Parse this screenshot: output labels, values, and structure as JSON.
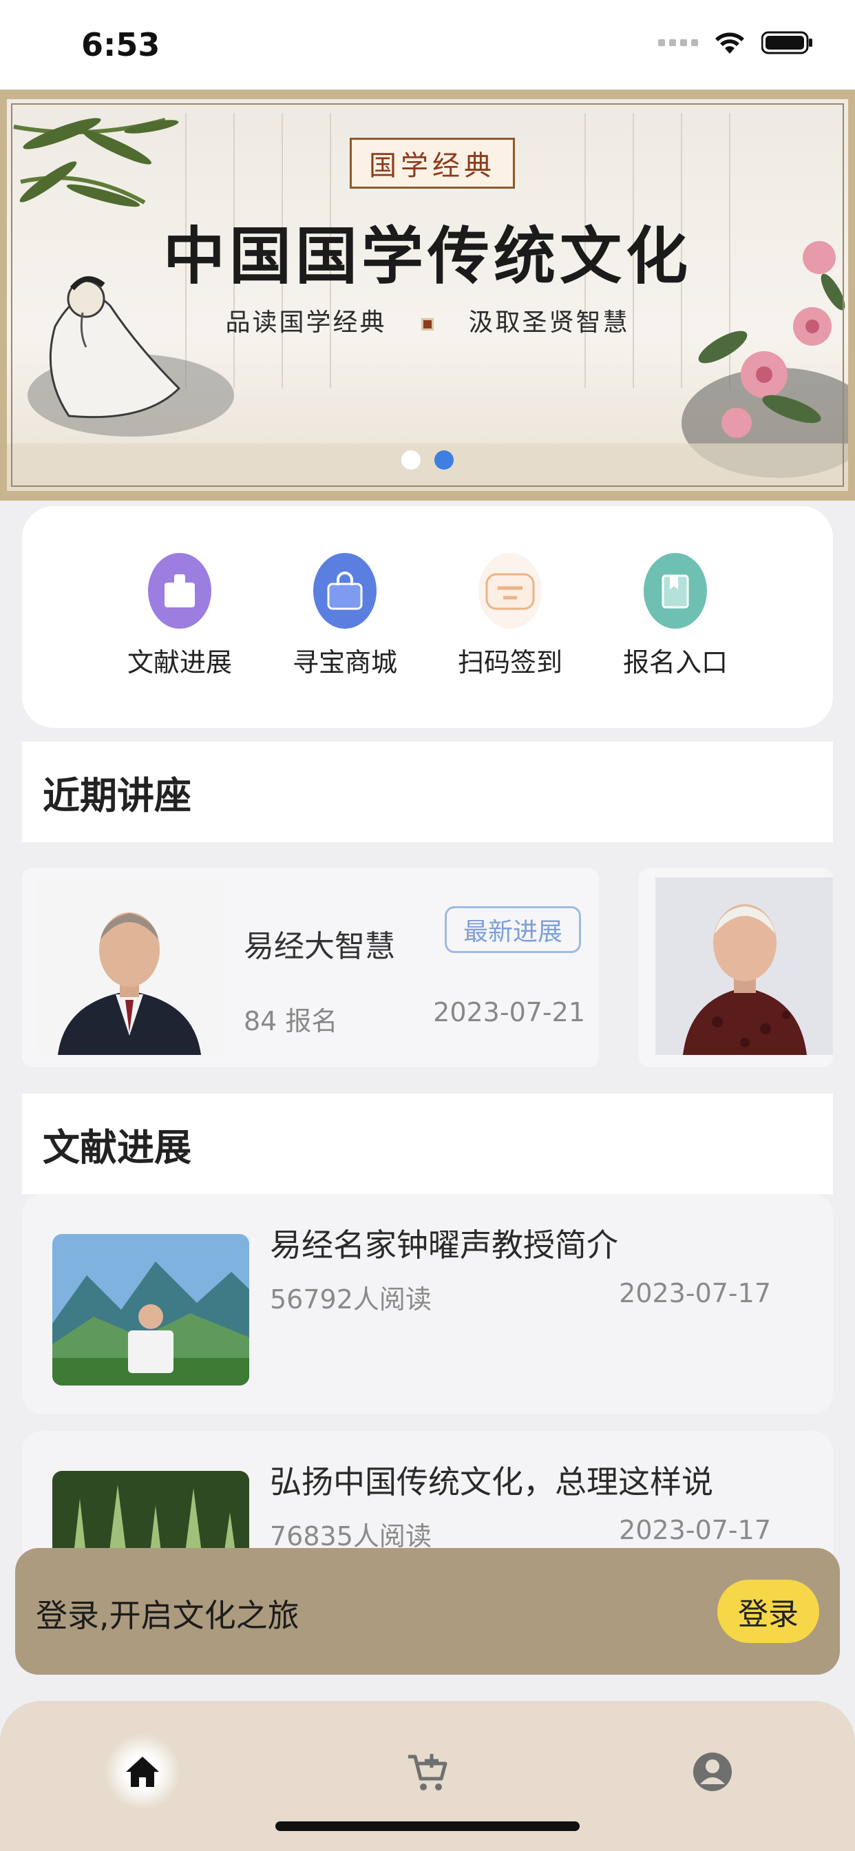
{
  "status_bar": {
    "time": "6:53"
  },
  "banner": {
    "tag": "国学经典",
    "title": "中国国学传统文化",
    "subtitle_left": "品读国学经典",
    "subtitle_right": "汲取圣贤智慧",
    "dots": 2,
    "active_dot": 1,
    "colors": {
      "frame": "#c8b58e",
      "active_dot": "#3f7fe0"
    }
  },
  "quick_actions": [
    {
      "label": "文献进展",
      "icon": "document-icon",
      "color": "#9b7ee0"
    },
    {
      "label": "寻宝商城",
      "icon": "shopping-bag-icon",
      "color": "#5b7fe0"
    },
    {
      "label": "扫码签到",
      "icon": "scan-icon",
      "color": "#e9b48a"
    },
    {
      "label": "报名入口",
      "icon": "book-icon",
      "color": "#6ec0b3"
    }
  ],
  "lectures": {
    "header": "近期讲座",
    "items": [
      {
        "title": "易经大智慧",
        "badge": "最新进展",
        "count": "84 报名",
        "date": "2023-07-21"
      }
    ]
  },
  "articles": {
    "header": "文献进展",
    "items": [
      {
        "title": "易经名家钟曜声教授简介",
        "reads": "56792人阅读",
        "date": "2023-07-17"
      },
      {
        "title": "弘扬中国传统文化，总理这样说",
        "reads": "76835人阅读",
        "date": "2023-07-17"
      }
    ]
  },
  "login_prompt": {
    "text": "登录,开启文化之旅",
    "button": "登录",
    "color": "#f5d748"
  },
  "tab_bar": {
    "tabs": [
      {
        "icon": "home-icon",
        "active": true
      },
      {
        "icon": "cart-icon",
        "active": false
      },
      {
        "icon": "profile-icon",
        "active": false
      }
    ]
  }
}
